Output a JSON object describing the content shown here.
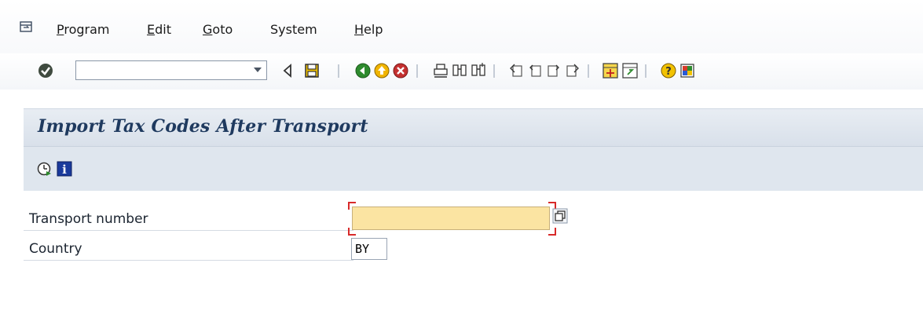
{
  "menu": {
    "items": [
      {
        "mnemonic": "P",
        "rest": "rogram"
      },
      {
        "mnemonic": "E",
        "rest": "dit"
      },
      {
        "mnemonic": "G",
        "rest": "oto"
      },
      {
        "mnemonic": "",
        "rest": "System"
      },
      {
        "mnemonic": "H",
        "rest": "elp"
      }
    ]
  },
  "toolbar": {
    "command_field": {
      "value": "",
      "placeholder": ""
    },
    "icons": [
      "enter-icon",
      "back-icon",
      "save-icon",
      "back-green-icon",
      "exit-icon",
      "cancel-icon",
      "print-icon",
      "find-icon",
      "find-next-icon",
      "first-page-icon",
      "previous-page-icon",
      "next-page-icon",
      "last-page-icon",
      "create-session-icon",
      "shortcut-icon",
      "help-icon",
      "customize-layout-icon"
    ]
  },
  "page": {
    "title": "Import Tax Codes After Transport",
    "app_icons": [
      "execute-icon",
      "information-icon"
    ]
  },
  "form": {
    "transport_number": {
      "label": "Transport number",
      "value": ""
    },
    "country": {
      "label": "Country",
      "value": "BY"
    }
  },
  "colors": {
    "title_text": "#1f3a5f",
    "required_field_bg": "#fbe4a2",
    "required_marker": "#d82a2a"
  }
}
